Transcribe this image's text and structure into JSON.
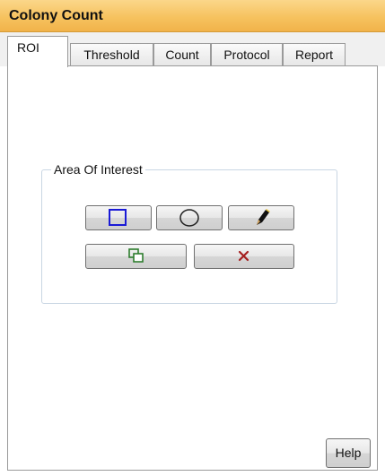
{
  "window": {
    "title": "Colony Count"
  },
  "tabs": [
    {
      "label": "ROI",
      "active": true
    },
    {
      "label": "Threshold",
      "active": false
    },
    {
      "label": "Count",
      "active": false
    },
    {
      "label": "Protocol",
      "active": false
    },
    {
      "label": "Report",
      "active": false
    }
  ],
  "roi_panel": {
    "group_title": "Area Of Interest",
    "tools": [
      {
        "icon": "rectangle-icon",
        "color": "#1a1ad6"
      },
      {
        "icon": "circle-icon",
        "color": "#222222"
      },
      {
        "icon": "pencil-icon",
        "color": "#111111"
      },
      {
        "icon": "copy-shapes-icon",
        "color": "#2e7d2e"
      },
      {
        "icon": "delete-x-icon",
        "color": "#a52020"
      }
    ]
  },
  "footer": {
    "help_label": "Help"
  },
  "colors": {
    "title_bar": "#f6c25f",
    "rectangle_tool": "#1a1ad6",
    "copy_tool": "#2e7d2e",
    "delete_tool": "#a52020"
  }
}
